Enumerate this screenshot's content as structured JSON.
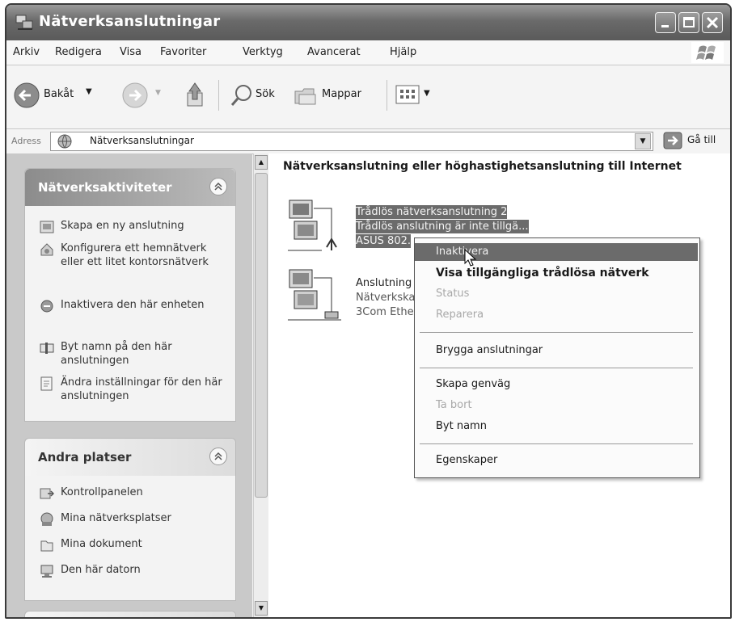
{
  "window": {
    "title": "Nätverksanslutningar",
    "accent": "#6a6a6a"
  },
  "menubar": {
    "items": [
      "Arkiv",
      "Redigera",
      "Visa",
      "Favoriter",
      "Verktyg",
      "Avancerat",
      "Hjälp"
    ]
  },
  "toolbar": {
    "back_label": "Bakåt",
    "search_label": "Sök",
    "folders_label": "Mappar"
  },
  "address": {
    "label": "Adress",
    "value": "Nätverksanslutningar",
    "go_label": "Gå till"
  },
  "sidebar": {
    "network_tasks": {
      "title": "Nätverksaktiviteter",
      "items": [
        {
          "label": "Skapa en ny anslutning",
          "icon": "new-connection-icon"
        },
        {
          "label": "Konfigurera ett hemnätverk eller ett litet kontorsnätverk",
          "icon": "home-network-icon"
        },
        {
          "label": "Inaktivera den här enheten",
          "icon": "disable-device-icon"
        },
        {
          "label": "Byt namn på den här anslutningen",
          "icon": "rename-icon"
        },
        {
          "label": "Ändra inställningar för den här anslutningen",
          "icon": "settings-icon"
        }
      ]
    },
    "other_places": {
      "title": "Andra platser",
      "items": [
        {
          "label": "Kontrollpanelen",
          "icon": "control-panel-icon"
        },
        {
          "label": "Mina nätverksplatser",
          "icon": "network-places-icon"
        },
        {
          "label": "Mina dokument",
          "icon": "documents-icon"
        },
        {
          "label": "Den här datorn",
          "icon": "computer-icon"
        }
      ]
    }
  },
  "main": {
    "group_title": "Nätverksanslutning eller höghastighetsanslutning till Internet",
    "connections": [
      {
        "name": "Trådlös nätverksanslutning 2",
        "status": "Trådlös anslutning är inte tillgä...",
        "device": "ASUS 802."
      },
      {
        "name": "Anslutning",
        "status": "Nätverkska",
        "device": "3Com Ethe"
      }
    ]
  },
  "context_menu": {
    "items": [
      {
        "label": "Inaktivera",
        "state": "highlighted"
      },
      {
        "label": "Visa tillgängliga trådlösa nätverk",
        "state": "default-bold"
      },
      {
        "label": "Status",
        "state": "disabled"
      },
      {
        "label": "Reparera",
        "state": "disabled"
      },
      {
        "label": "Brygga anslutningar",
        "state": "enabled"
      },
      {
        "label": "Skapa genväg",
        "state": "enabled"
      },
      {
        "label": "Ta bort",
        "state": "disabled"
      },
      {
        "label": "Byt namn",
        "state": "enabled"
      },
      {
        "label": "Egenskaper",
        "state": "enabled"
      }
    ]
  }
}
